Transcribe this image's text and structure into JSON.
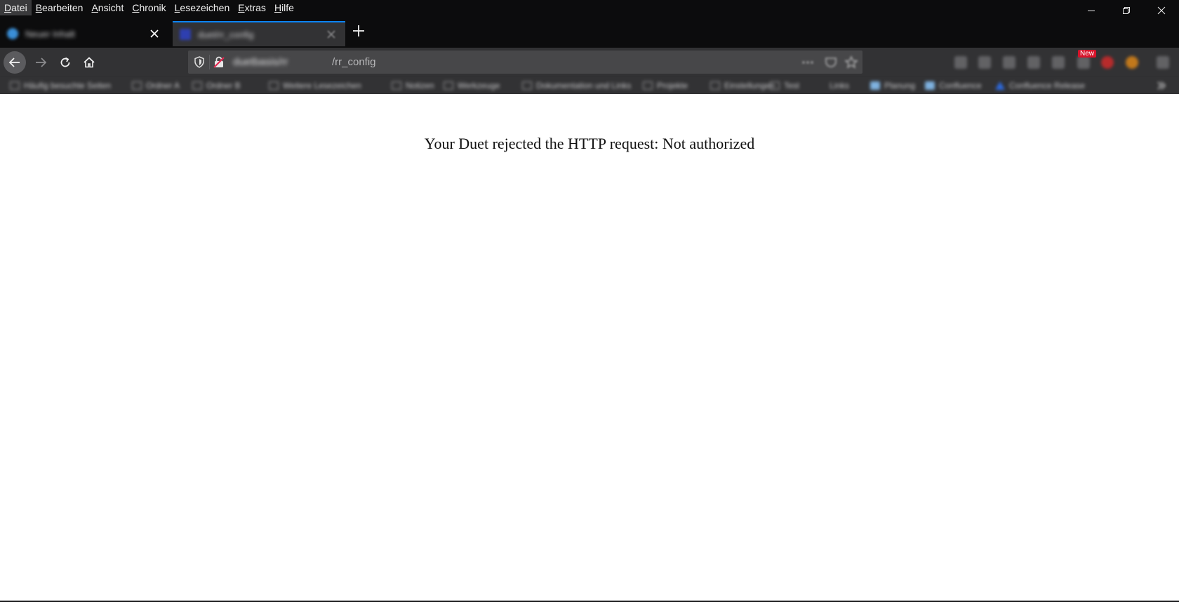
{
  "menu": {
    "items": [
      {
        "label": "Datei",
        "accel": "D",
        "rest": "atei"
      },
      {
        "label": "Bearbeiten",
        "accel": "B",
        "rest": "earbeiten"
      },
      {
        "label": "Ansicht",
        "accel": "A",
        "rest": "nsicht"
      },
      {
        "label": "Chronik",
        "accel": "C",
        "rest": "hronik"
      },
      {
        "label": "Lesezeichen",
        "accel": "L",
        "rest": "esezeichen"
      },
      {
        "label": "Extras",
        "accel": "E",
        "rest": "xtras"
      },
      {
        "label": "Hilfe",
        "accel": "H",
        "rest": "ilfe"
      }
    ]
  },
  "window_controls": [
    "minimize-icon",
    "restore-icon",
    "close-icon"
  ],
  "tabs": [
    {
      "title": "Neuer Inhalt",
      "active": false,
      "icon": "globe-icon"
    },
    {
      "title": "duet/rr_config",
      "active": true,
      "icon": "page-icon"
    }
  ],
  "navbar": {
    "url_host": "duetbasis/rr",
    "url_path": "/rr_config",
    "badge_new": "New",
    "colors": {
      "toolbar": "#323234",
      "urlbar": "#474749",
      "tab_accent": "#0a84ff"
    }
  },
  "bookmarks": [
    "Häufig besuchte Seiten",
    "Ordner A",
    "Ordner B",
    "Weitere Lesezeichen",
    "Notizen",
    "Werkzeuge",
    "Dokumentation und Links",
    "Projekte",
    "Einstellungen",
    "Test",
    "Links",
    "Planung",
    "Confluence",
    "Confluence Release"
  ],
  "page": {
    "message": "Your Duet rejected the HTTP request: Not authorized"
  }
}
